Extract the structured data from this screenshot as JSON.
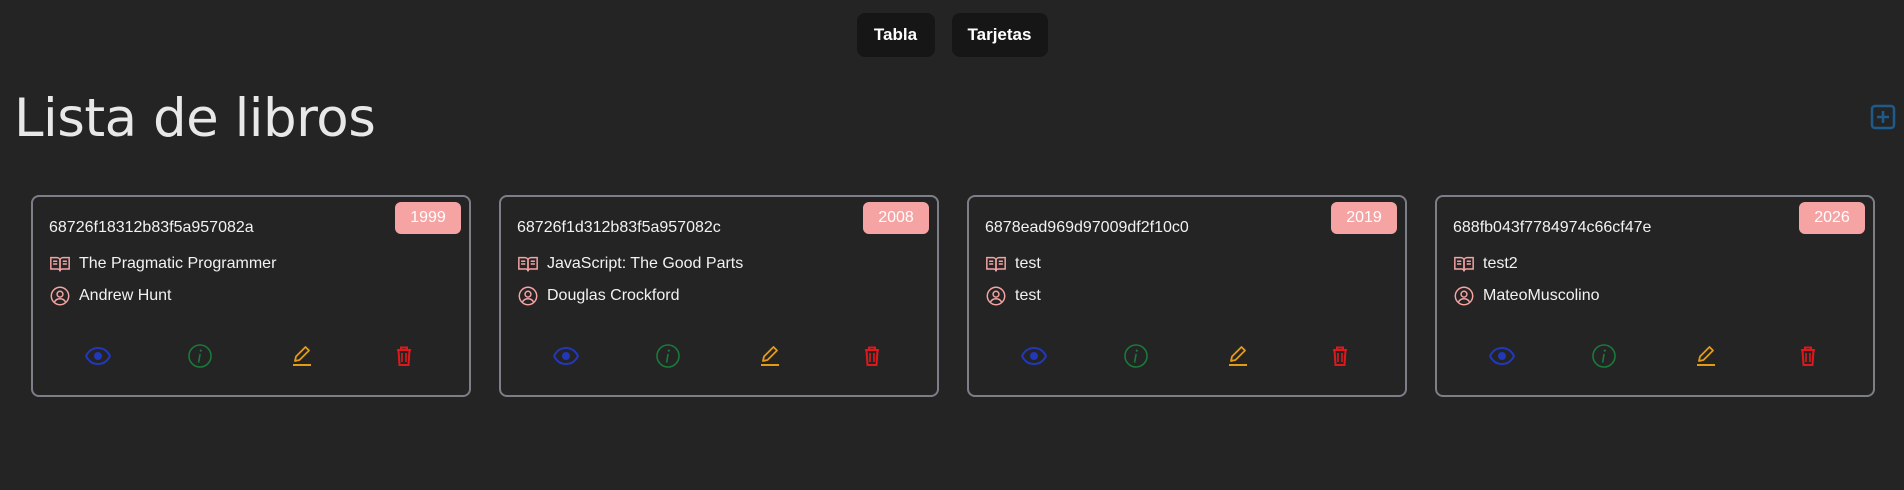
{
  "view_toggle": {
    "table_label": "Tabla",
    "cards_label": "Tarjetas"
  },
  "page": {
    "title": "Lista de libros",
    "add_icon": "plus-square-icon",
    "add_color": "#1e5b8c"
  },
  "colors": {
    "badge": "#f5a3a3",
    "meta_icon": "#f5a3a3",
    "view": "#2238b8",
    "info": "#1a7a3a",
    "edit": "#e39a17",
    "delete": "#e0181b"
  },
  "books": [
    {
      "id": "68726f18312b83f5a957082a",
      "year": "1999",
      "title": "The Pragmatic Programmer",
      "author": "Andrew Hunt"
    },
    {
      "id": "68726f1d312b83f5a957082c",
      "year": "2008",
      "title": "JavaScript: The Good Parts",
      "author": "Douglas Crockford"
    },
    {
      "id": "6878ead969d97009df2f10c0",
      "year": "2019",
      "title": "test",
      "author": "test"
    },
    {
      "id": "688fb043f7784974c66cf47e",
      "year": "2026",
      "title": "test2",
      "author": "MateoMuscolino"
    }
  ]
}
